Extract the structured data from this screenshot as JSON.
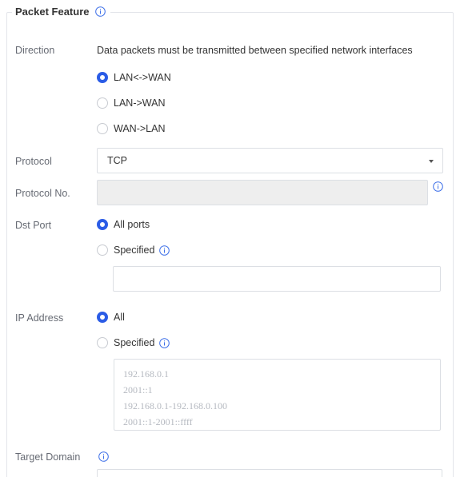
{
  "section": {
    "title": "Packet Feature"
  },
  "direction": {
    "label": "Direction",
    "description": "Data packets must be transmitted between specified network interfaces",
    "options": [
      {
        "label": "LAN<->WAN",
        "checked": true
      },
      {
        "label": "LAN->WAN",
        "checked": false
      },
      {
        "label": "WAN->LAN",
        "checked": false
      }
    ]
  },
  "protocol": {
    "label": "Protocol",
    "value": "TCP"
  },
  "protocol_no": {
    "label": "Protocol No.",
    "value": ""
  },
  "dst_port": {
    "label": "Dst Port",
    "options": [
      {
        "label": "All ports",
        "checked": true
      },
      {
        "label": "Specified",
        "checked": false
      }
    ],
    "input_value": ""
  },
  "ip_address": {
    "label": "IP Address",
    "options": [
      {
        "label": "All",
        "checked": true
      },
      {
        "label": "Specified",
        "checked": false
      }
    ],
    "placeholder_lines": [
      "192.168.0.1",
      "2001::1",
      "192.168.0.1-192.168.0.100",
      "2001::1-2001::ffff"
    ]
  },
  "target_domain": {
    "label": "Target Domain"
  },
  "colors": {
    "accent": "#2b5ce6",
    "info_icon": "#3d6fe8"
  }
}
